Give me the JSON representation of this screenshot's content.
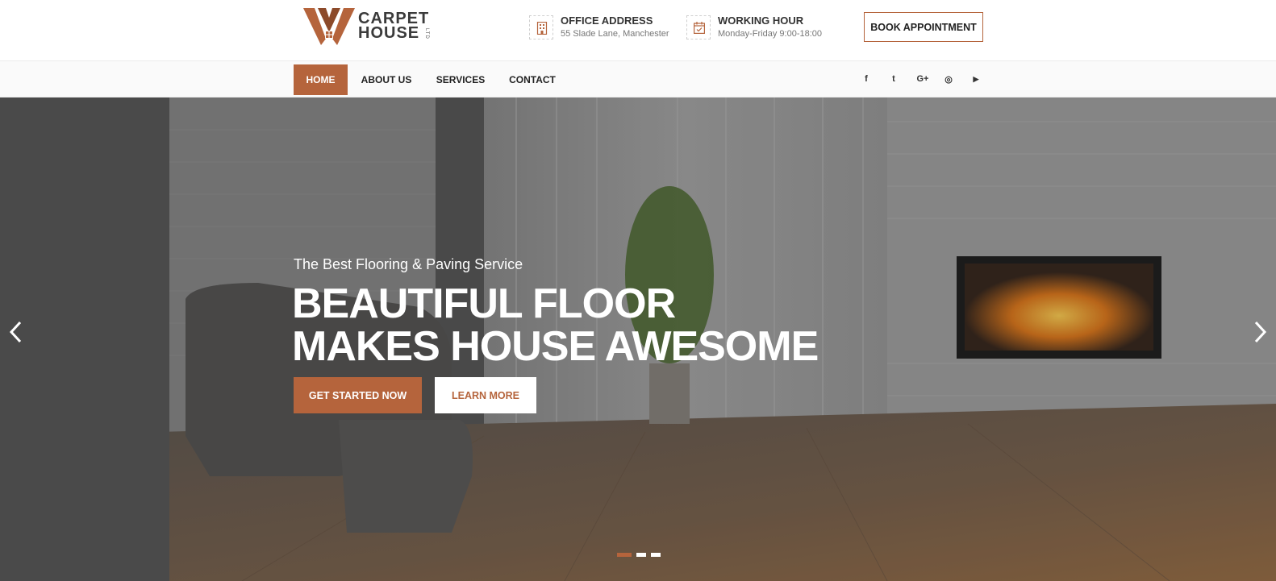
{
  "brand": {
    "name_line1": "CARPET",
    "name_line2": "HOUSE",
    "suffix": "LTD",
    "accent_color": "#b5643c"
  },
  "header": {
    "office": {
      "icon": "building-icon",
      "title": "OFFICE ADDRESS",
      "value": "55 Slade Lane, Manchester"
    },
    "hours": {
      "icon": "calendar-check-icon",
      "title": "WORKING HOUR",
      "value": "Monday-Friday 9:00-18:00"
    },
    "book_label": "BOOK APPOINTMENT"
  },
  "nav": {
    "items": [
      {
        "label": "HOME",
        "active": true
      },
      {
        "label": "ABOUT US",
        "active": false
      },
      {
        "label": "SERVICES",
        "active": false
      },
      {
        "label": "CONTACT",
        "active": false
      }
    ],
    "social": [
      {
        "icon": "facebook-icon",
        "glyph": "f"
      },
      {
        "icon": "twitter-icon",
        "glyph": "t"
      },
      {
        "icon": "google-plus-icon",
        "glyph": "G+"
      },
      {
        "icon": "instagram-icon",
        "glyph": "◎"
      },
      {
        "icon": "youtube-icon",
        "glyph": "▶"
      }
    ]
  },
  "hero": {
    "subtitle": "The Best Flooring & Paving Service",
    "headline_line1": "BEAUTIFUL FLOOR",
    "headline_line2": "MAKES HOUSE AWESOME",
    "primary_cta": "GET STARTED NOW",
    "secondary_cta": "LEARN MORE",
    "prev_icon": "chevron-left-icon",
    "next_icon": "chevron-right-icon",
    "slides_total": 3,
    "slide_active": 1
  }
}
